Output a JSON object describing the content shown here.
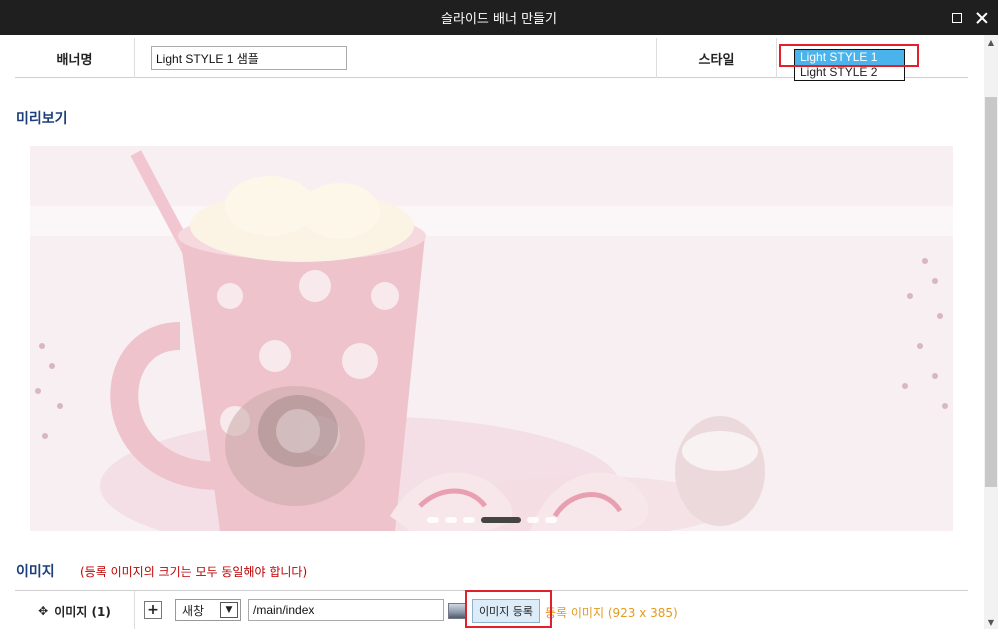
{
  "window": {
    "title": "슬라이드 배너 만들기"
  },
  "banner": {
    "name_label": "배너명",
    "name_value": "Light STYLE 1 샘플",
    "style_label": "스타일",
    "style_options": [
      "Light STYLE 1",
      "Light STYLE 2"
    ],
    "style_selected": "Light STYLE 1"
  },
  "preview": {
    "title": "미리보기",
    "slide_count": 6,
    "active_slide": 4
  },
  "images": {
    "title": "이미지",
    "note": "(등록 이미지의 크기는 모두 동일해야 합니다)",
    "row_label": "이미지 (1)",
    "add_label": "+",
    "target_value": "새창",
    "link_value": "/main/index",
    "register_button": "이미지 등록",
    "registered_info": "등록 이미지 (923 x 385)"
  },
  "colors": {
    "accent": "#1c3f7a",
    "note": "#c00000",
    "highlight": "#e0202a",
    "info": "#e39a1e",
    "selected": "#4ab3ec"
  }
}
